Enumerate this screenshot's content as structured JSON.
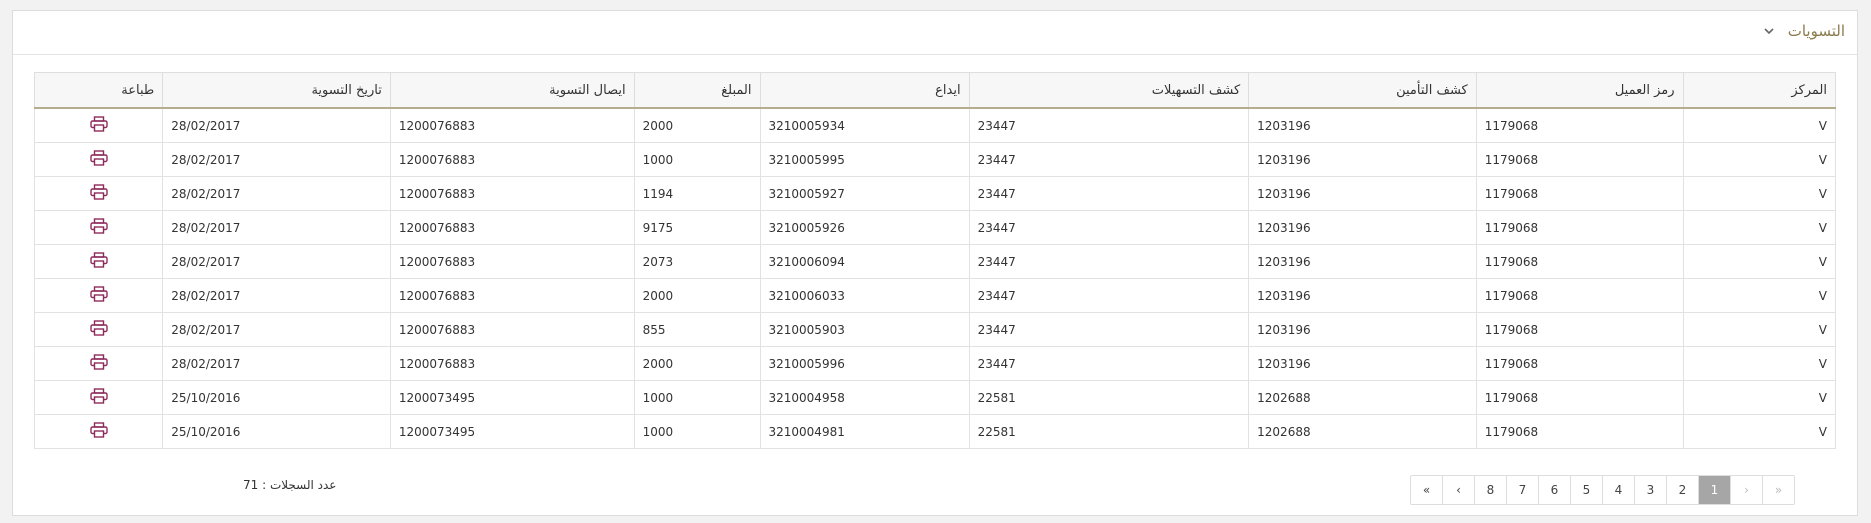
{
  "panel": {
    "title": "التسويات",
    "toggle_icon": "chevron-down-icon"
  },
  "table": {
    "headers": [
      "المركز",
      "رمز العميل",
      "كشف التأمين",
      "كشف التسهيلات",
      "ايداع",
      "المبلغ",
      "ايصال التسوية",
      "تاريخ التسوية",
      "طباعة"
    ],
    "rows": [
      [
        "V",
        "1179068",
        "1203196",
        "23447",
        "3210005934",
        "2000",
        "1200076883",
        "28/02/2017"
      ],
      [
        "V",
        "1179068",
        "1203196",
        "23447",
        "3210005995",
        "1000",
        "1200076883",
        "28/02/2017"
      ],
      [
        "V",
        "1179068",
        "1203196",
        "23447",
        "3210005927",
        "1194",
        "1200076883",
        "28/02/2017"
      ],
      [
        "V",
        "1179068",
        "1203196",
        "23447",
        "3210005926",
        "9175",
        "1200076883",
        "28/02/2017"
      ],
      [
        "V",
        "1179068",
        "1203196",
        "23447",
        "3210006094",
        "2073",
        "1200076883",
        "28/02/2017"
      ],
      [
        "V",
        "1179068",
        "1203196",
        "23447",
        "3210006033",
        "2000",
        "1200076883",
        "28/02/2017"
      ],
      [
        "V",
        "1179068",
        "1203196",
        "23447",
        "3210005903",
        "855",
        "1200076883",
        "28/02/2017"
      ],
      [
        "V",
        "1179068",
        "1203196",
        "23447",
        "3210005996",
        "2000",
        "1200076883",
        "28/02/2017"
      ],
      [
        "V",
        "1179068",
        "1202688",
        "22581",
        "3210004958",
        "1000",
        "1200073495",
        "25/10/2016"
      ],
      [
        "V",
        "1179068",
        "1202688",
        "22581",
        "3210004981",
        "1000",
        "1200073495",
        "25/10/2016"
      ]
    ],
    "print_icon": "printer-icon",
    "print_icon_color": "#8e2a5a"
  },
  "footer": {
    "records_label": "عدد السجلات : 71",
    "pagination": {
      "first": "«",
      "prev": "‹",
      "pages": [
        "1",
        "2",
        "3",
        "4",
        "5",
        "6",
        "7",
        "8"
      ],
      "active": "1",
      "next": "›",
      "last": "»"
    }
  },
  "colors": {
    "title": "#8b7a4c",
    "header_underline": "#b6ad8e",
    "active_page": "#a6a6a6"
  }
}
